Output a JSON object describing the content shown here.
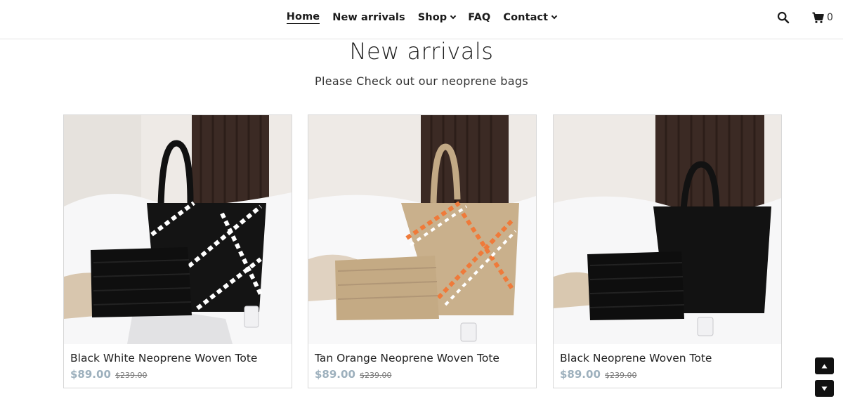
{
  "nav": {
    "items": [
      {
        "label": "Home",
        "active": true
      },
      {
        "label": "New arrivals"
      },
      {
        "label": "Shop",
        "dropdown": true
      },
      {
        "label": "FAQ"
      },
      {
        "label": "Contact",
        "dropdown": true
      }
    ],
    "search_icon": "search-icon",
    "cart_icon": "cart-icon",
    "cart_count": "0"
  },
  "hero": {
    "title": "New arrivals",
    "subtitle": "Please Check out our neoprene bags"
  },
  "products": [
    {
      "name": "Black White Neoprene Woven Tote",
      "price": "$89.00",
      "compare_price": "$239.00",
      "bag_color": "#111111",
      "accent": "#ffffff"
    },
    {
      "name": "Tan Orange Neoprene Woven Tote",
      "price": "$89.00",
      "compare_price": "$239.00",
      "bag_color": "#c8b08c",
      "accent": "#ef7a3a"
    },
    {
      "name": "Black Neoprene Woven Tote",
      "price": "$89.00",
      "compare_price": "$239.00",
      "bag_color": "#141414",
      "accent": ""
    }
  ],
  "colors": {
    "price": "#9db0bd",
    "background": "#ffffff",
    "scroll_button": "#111111"
  },
  "scroll": {
    "up_icon": "arrow-up-icon",
    "down_icon": "arrow-down-icon"
  }
}
